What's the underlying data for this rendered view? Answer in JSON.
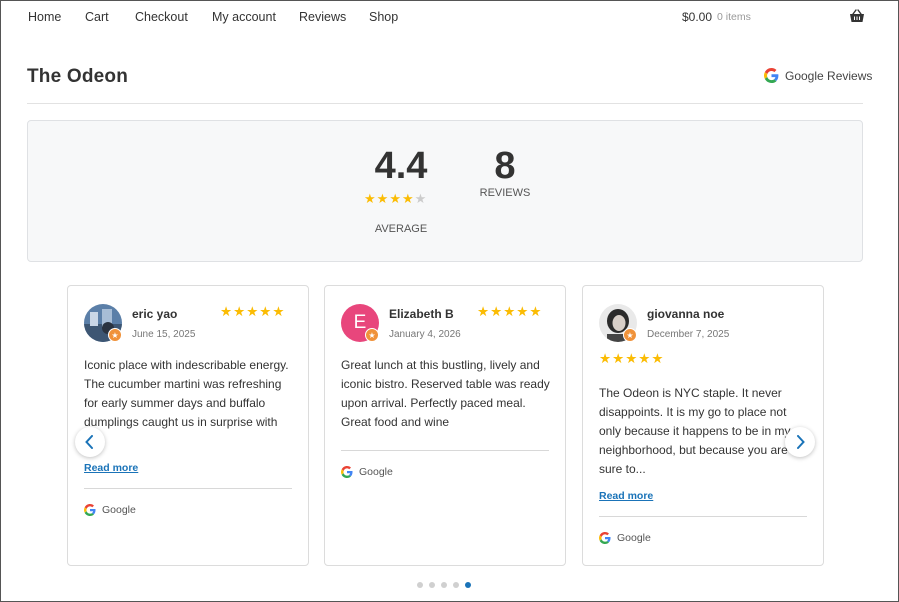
{
  "nav": {
    "items": [
      "Home",
      "Cart",
      "Checkout",
      "My account",
      "Reviews",
      "Shop"
    ],
    "cart_total": "$0.00",
    "cart_count": "0 items",
    "cart_icon": "basket-icon"
  },
  "page": {
    "title": "The Odeon",
    "reviews_source": "Google Reviews"
  },
  "summary": {
    "average": "4.4",
    "average_label": "AVERAGE",
    "rating_out_of_5": 4.4,
    "count": "8",
    "count_label": "REVIEWS"
  },
  "reviews": [
    {
      "name": "eric yao",
      "date": "June 15, 2025",
      "rating": 5,
      "text": "Iconic place with indescribable energy. The cucumber martini was refreshing for early summer days and buffalo dumplings caught us in surprise with",
      "read_more": "Read more",
      "source": "Google"
    },
    {
      "name": "Elizabeth B",
      "initial": "E",
      "date": "January 4, 2026",
      "rating": 5,
      "text": "Great lunch at this bustling, lively and iconic bistro. Reserved table was ready upon arrival. Perfectly paced meal. Great food and wine",
      "source": "Google"
    },
    {
      "name": "giovanna noe",
      "date": "December 7, 2025",
      "rating": 5,
      "text": "The Odeon is NYC staple. It never disappoints. It is my go to place not only because it happens to be in my neighborhood, but because you are sure to...",
      "read_more": "Read more",
      "source": "Google"
    }
  ],
  "carousel": {
    "pages": 5,
    "active_index": 4
  },
  "colors": {
    "star": "#fbbc04",
    "star_empty": "#cccccc",
    "link": "#1a73b8",
    "avatar_pink": "#e8467c",
    "badge_orange": "#f0923a"
  }
}
